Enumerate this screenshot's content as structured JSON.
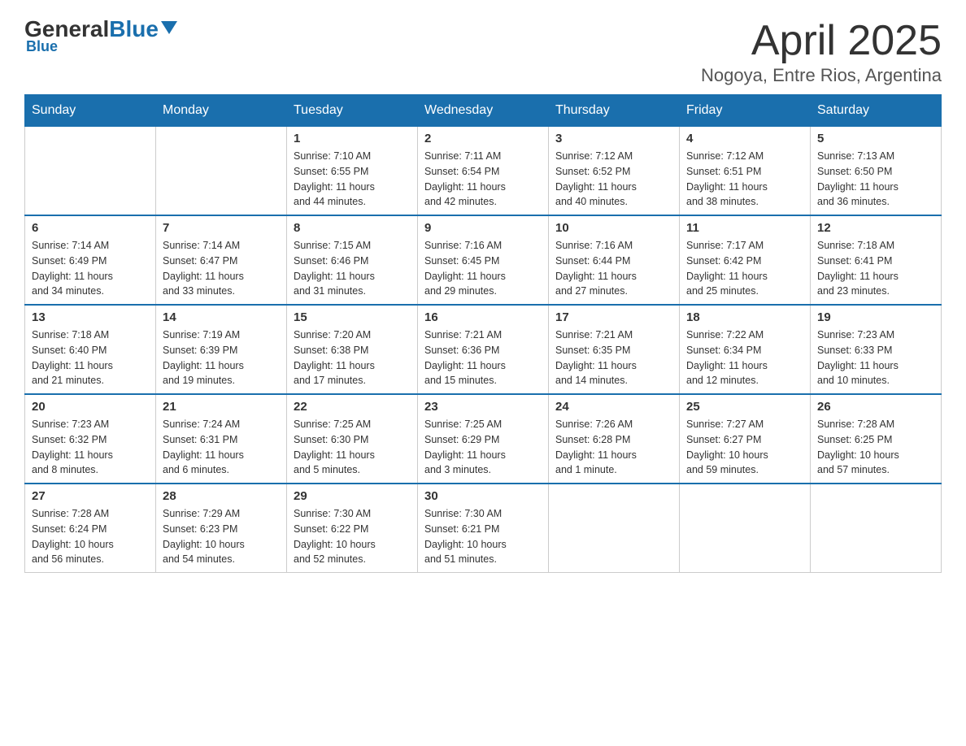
{
  "header": {
    "logo_general": "General",
    "logo_blue": "Blue",
    "title": "April 2025",
    "subtitle": "Nogoya, Entre Rios, Argentina"
  },
  "weekdays": [
    "Sunday",
    "Monday",
    "Tuesday",
    "Wednesday",
    "Thursday",
    "Friday",
    "Saturday"
  ],
  "weeks": [
    [
      {
        "day": "",
        "info": []
      },
      {
        "day": "",
        "info": []
      },
      {
        "day": "1",
        "info": [
          "Sunrise: 7:10 AM",
          "Sunset: 6:55 PM",
          "Daylight: 11 hours",
          "and 44 minutes."
        ]
      },
      {
        "day": "2",
        "info": [
          "Sunrise: 7:11 AM",
          "Sunset: 6:54 PM",
          "Daylight: 11 hours",
          "and 42 minutes."
        ]
      },
      {
        "day": "3",
        "info": [
          "Sunrise: 7:12 AM",
          "Sunset: 6:52 PM",
          "Daylight: 11 hours",
          "and 40 minutes."
        ]
      },
      {
        "day": "4",
        "info": [
          "Sunrise: 7:12 AM",
          "Sunset: 6:51 PM",
          "Daylight: 11 hours",
          "and 38 minutes."
        ]
      },
      {
        "day": "5",
        "info": [
          "Sunrise: 7:13 AM",
          "Sunset: 6:50 PM",
          "Daylight: 11 hours",
          "and 36 minutes."
        ]
      }
    ],
    [
      {
        "day": "6",
        "info": [
          "Sunrise: 7:14 AM",
          "Sunset: 6:49 PM",
          "Daylight: 11 hours",
          "and 34 minutes."
        ]
      },
      {
        "day": "7",
        "info": [
          "Sunrise: 7:14 AM",
          "Sunset: 6:47 PM",
          "Daylight: 11 hours",
          "and 33 minutes."
        ]
      },
      {
        "day": "8",
        "info": [
          "Sunrise: 7:15 AM",
          "Sunset: 6:46 PM",
          "Daylight: 11 hours",
          "and 31 minutes."
        ]
      },
      {
        "day": "9",
        "info": [
          "Sunrise: 7:16 AM",
          "Sunset: 6:45 PM",
          "Daylight: 11 hours",
          "and 29 minutes."
        ]
      },
      {
        "day": "10",
        "info": [
          "Sunrise: 7:16 AM",
          "Sunset: 6:44 PM",
          "Daylight: 11 hours",
          "and 27 minutes."
        ]
      },
      {
        "day": "11",
        "info": [
          "Sunrise: 7:17 AM",
          "Sunset: 6:42 PM",
          "Daylight: 11 hours",
          "and 25 minutes."
        ]
      },
      {
        "day": "12",
        "info": [
          "Sunrise: 7:18 AM",
          "Sunset: 6:41 PM",
          "Daylight: 11 hours",
          "and 23 minutes."
        ]
      }
    ],
    [
      {
        "day": "13",
        "info": [
          "Sunrise: 7:18 AM",
          "Sunset: 6:40 PM",
          "Daylight: 11 hours",
          "and 21 minutes."
        ]
      },
      {
        "day": "14",
        "info": [
          "Sunrise: 7:19 AM",
          "Sunset: 6:39 PM",
          "Daylight: 11 hours",
          "and 19 minutes."
        ]
      },
      {
        "day": "15",
        "info": [
          "Sunrise: 7:20 AM",
          "Sunset: 6:38 PM",
          "Daylight: 11 hours",
          "and 17 minutes."
        ]
      },
      {
        "day": "16",
        "info": [
          "Sunrise: 7:21 AM",
          "Sunset: 6:36 PM",
          "Daylight: 11 hours",
          "and 15 minutes."
        ]
      },
      {
        "day": "17",
        "info": [
          "Sunrise: 7:21 AM",
          "Sunset: 6:35 PM",
          "Daylight: 11 hours",
          "and 14 minutes."
        ]
      },
      {
        "day": "18",
        "info": [
          "Sunrise: 7:22 AM",
          "Sunset: 6:34 PM",
          "Daylight: 11 hours",
          "and 12 minutes."
        ]
      },
      {
        "day": "19",
        "info": [
          "Sunrise: 7:23 AM",
          "Sunset: 6:33 PM",
          "Daylight: 11 hours",
          "and 10 minutes."
        ]
      }
    ],
    [
      {
        "day": "20",
        "info": [
          "Sunrise: 7:23 AM",
          "Sunset: 6:32 PM",
          "Daylight: 11 hours",
          "and 8 minutes."
        ]
      },
      {
        "day": "21",
        "info": [
          "Sunrise: 7:24 AM",
          "Sunset: 6:31 PM",
          "Daylight: 11 hours",
          "and 6 minutes."
        ]
      },
      {
        "day": "22",
        "info": [
          "Sunrise: 7:25 AM",
          "Sunset: 6:30 PM",
          "Daylight: 11 hours",
          "and 5 minutes."
        ]
      },
      {
        "day": "23",
        "info": [
          "Sunrise: 7:25 AM",
          "Sunset: 6:29 PM",
          "Daylight: 11 hours",
          "and 3 minutes."
        ]
      },
      {
        "day": "24",
        "info": [
          "Sunrise: 7:26 AM",
          "Sunset: 6:28 PM",
          "Daylight: 11 hours",
          "and 1 minute."
        ]
      },
      {
        "day": "25",
        "info": [
          "Sunrise: 7:27 AM",
          "Sunset: 6:27 PM",
          "Daylight: 10 hours",
          "and 59 minutes."
        ]
      },
      {
        "day": "26",
        "info": [
          "Sunrise: 7:28 AM",
          "Sunset: 6:25 PM",
          "Daylight: 10 hours",
          "and 57 minutes."
        ]
      }
    ],
    [
      {
        "day": "27",
        "info": [
          "Sunrise: 7:28 AM",
          "Sunset: 6:24 PM",
          "Daylight: 10 hours",
          "and 56 minutes."
        ]
      },
      {
        "day": "28",
        "info": [
          "Sunrise: 7:29 AM",
          "Sunset: 6:23 PM",
          "Daylight: 10 hours",
          "and 54 minutes."
        ]
      },
      {
        "day": "29",
        "info": [
          "Sunrise: 7:30 AM",
          "Sunset: 6:22 PM",
          "Daylight: 10 hours",
          "and 52 minutes."
        ]
      },
      {
        "day": "30",
        "info": [
          "Sunrise: 7:30 AM",
          "Sunset: 6:21 PM",
          "Daylight: 10 hours",
          "and 51 minutes."
        ]
      },
      {
        "day": "",
        "info": []
      },
      {
        "day": "",
        "info": []
      },
      {
        "day": "",
        "info": []
      }
    ]
  ]
}
